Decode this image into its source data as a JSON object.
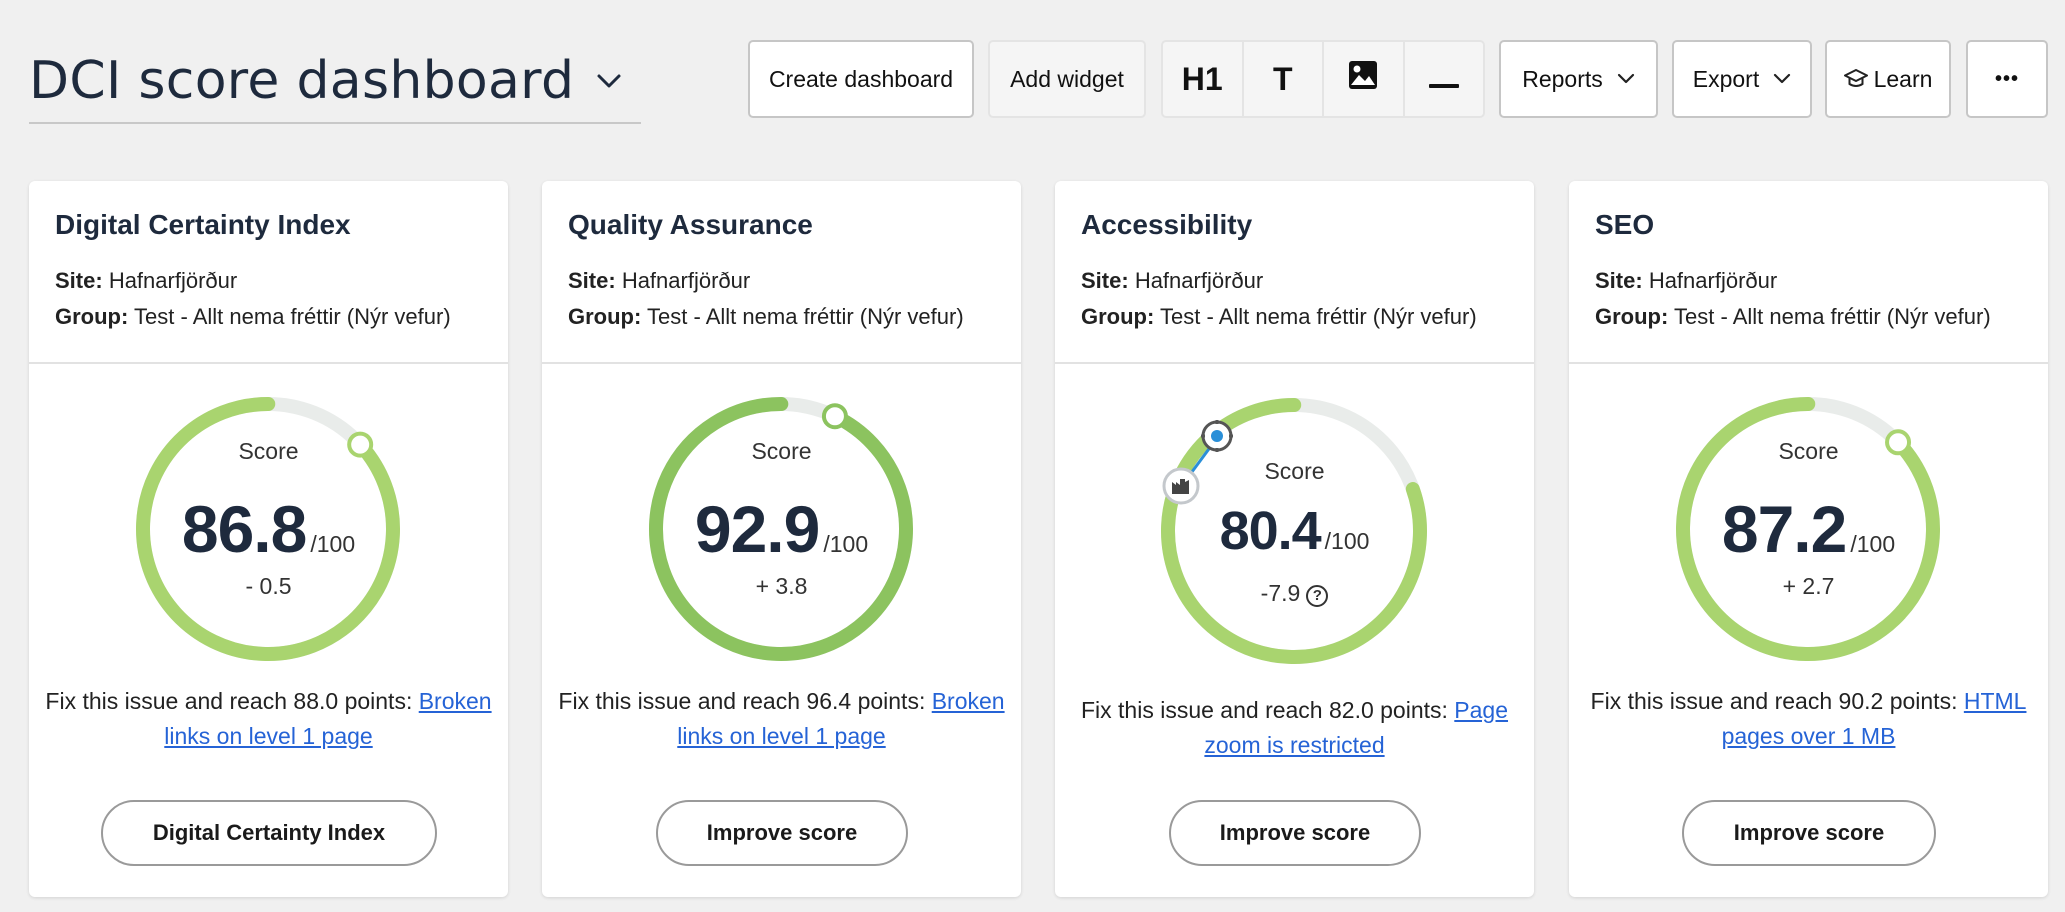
{
  "header": {
    "title": "DCI score dashboard",
    "buttons": {
      "create_dashboard": "Create dashboard",
      "add_widget": "Add widget",
      "heading": "H1",
      "text": "T",
      "reports": "Reports",
      "export": "Export",
      "learn": "Learn",
      "more": "•••"
    },
    "icons": [
      "chevron-down-icon",
      "image-icon",
      "divider-icon",
      "graduation-cap-icon",
      "more-icon"
    ]
  },
  "labels": {
    "site": "Site:",
    "group": "Group:",
    "score": "Score",
    "max": "/100"
  },
  "colors": {
    "gauge_light": "#a9d46f",
    "gauge_dark": "#8cc35f",
    "gauge_track": "#e9ecea",
    "link": "#2563d6",
    "text_dark": "#1e2a3d"
  },
  "cards": [
    {
      "title": "Digital Certainty Index",
      "site": "Hafnarfjörður",
      "group": "Test - Allt nema fréttir (Nýr vefur)",
      "score": 86.8,
      "score_text": "86.8",
      "delta": "- 0.5",
      "fix_text": "Fix this issue and reach 88.0 points:",
      "fix_link": "Broken links on level 1 page",
      "button": "Digital Certainty Index"
    },
    {
      "title": "Quality Assurance",
      "site": "Hafnarfjörður",
      "group": "Test - Allt nema fréttir (Nýr vefur)",
      "score": 92.9,
      "score_text": "92.9",
      "delta": "+ 3.8",
      "fix_text": "Fix this issue and reach 96.4 points:",
      "fix_link": "Broken links on level 1 page",
      "button": "Improve score"
    },
    {
      "title": "Accessibility",
      "site": "Hafnarfjörður",
      "group": "Test - Allt nema fréttir (Nýr vefur)",
      "score": 80.4,
      "score_text": "80.4",
      "delta": "-7.9",
      "fix_text": "Fix this issue and reach 82.0 points:",
      "fix_link": "Page zoom is restricted",
      "button": "Improve score"
    },
    {
      "title": "SEO",
      "site": "Hafnarfjörður",
      "group": "Test - Allt nema fréttir (Nýr vefur)",
      "score": 87.2,
      "score_text": "87.2",
      "delta": "+ 2.7",
      "fix_text": "Fix this issue and reach 90.2 points:",
      "fix_link": "HTML pages over 1 MB",
      "button": "Improve score"
    }
  ]
}
